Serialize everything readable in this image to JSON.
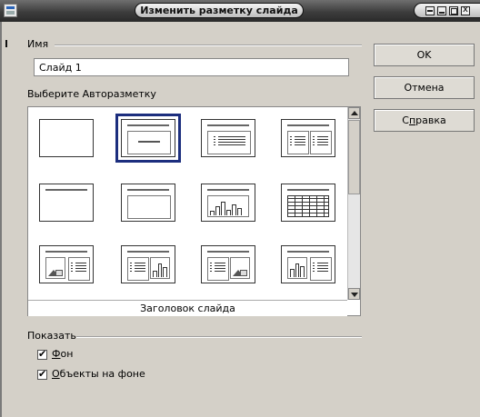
{
  "window": {
    "title": "Изменить разметку слайда"
  },
  "name_section": {
    "label": "Имя",
    "value": "Слайд 1"
  },
  "layout_section": {
    "label": "Выберите Авторазметку",
    "selected_caption": "Заголовок слайда",
    "selected_index": 1
  },
  "buttons": {
    "ok": "OK",
    "cancel": "Отмена",
    "help_prefix": "С",
    "help_underline": "п",
    "help_rest": "равка"
  },
  "show_section": {
    "label": "Показать",
    "background_underline": "Ф",
    "background_rest": "он",
    "background_checked": true,
    "objects_underline": "О",
    "objects_rest": "бъекты на фоне",
    "objects_checked": true
  }
}
